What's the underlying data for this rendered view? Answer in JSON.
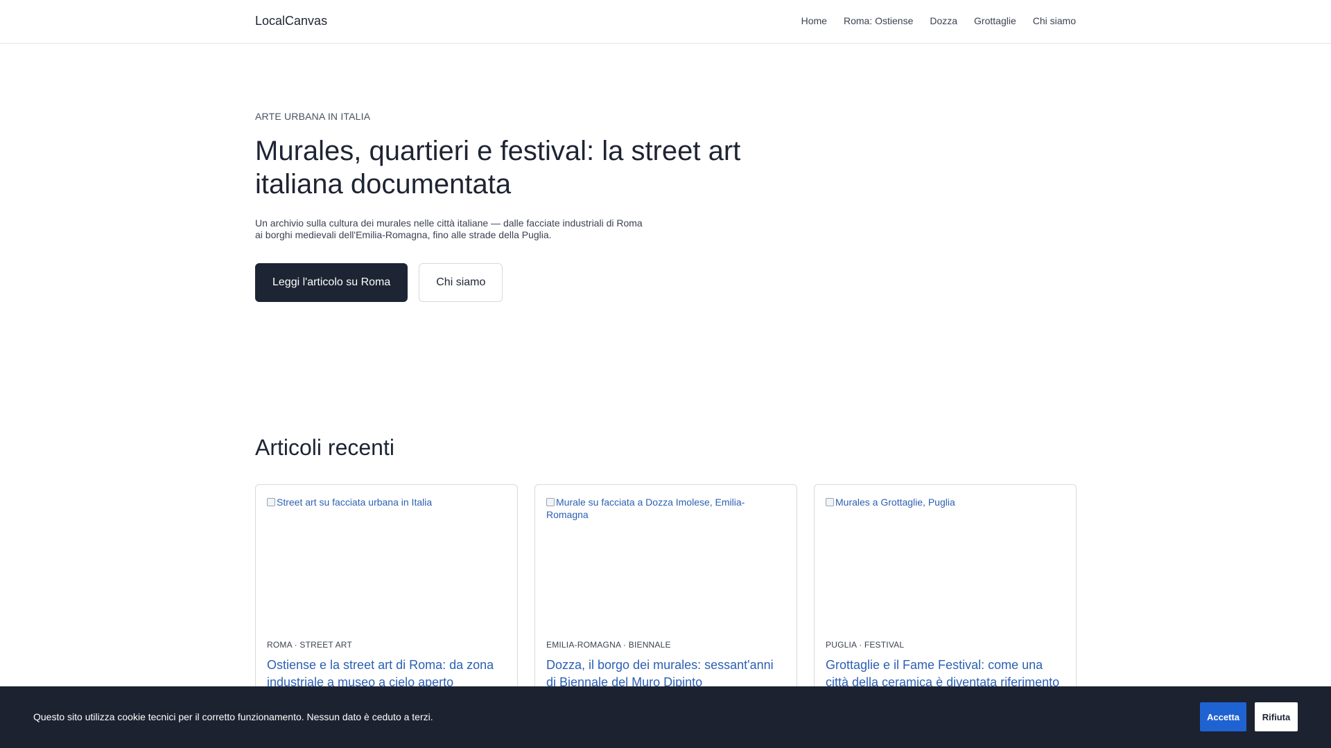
{
  "header": {
    "brand": "LocalCanvas",
    "nav": [
      "Home",
      "Roma: Ostiense",
      "Dozza",
      "Grottaglie",
      "Chi siamo"
    ]
  },
  "hero": {
    "eyebrow": "ARTE URBANA IN ITALIA",
    "title": "Murales, quartieri e festival: la street art italiana documentata",
    "lead": "Un archivio sulla cultura dei murales nelle città italiane — dalle facciate industriali di Roma ai borghi medievali dell'Emilia-Romagna, fino alle strade della Puglia.",
    "primary_cta": "Leggi l'articolo su Roma",
    "secondary_cta": "Chi siamo"
  },
  "recent": {
    "title": "Articoli recenti",
    "cards": [
      {
        "image_alt": "Street art su facciata urbana in Italia",
        "meta": "ROMA · STREET ART",
        "title": "Ostiense e la street art di Roma: da zona industriale a museo a cielo aperto"
      },
      {
        "image_alt": "Murale su facciata a Dozza Imolese, Emilia-Romagna",
        "meta": "EMILIA-ROMAGNA · BIENNALE",
        "title": "Dozza, il borgo dei murales: sessant'anni di Biennale del Muro Dipinto"
      },
      {
        "image_alt": "Murales a Grottaglie, Puglia",
        "meta": "PUGLIA · FESTIVAL",
        "title": "Grottaglie e il Fame Festival: come una città della ceramica è diventata riferimento"
      }
    ]
  },
  "cookie": {
    "text": "Questo sito utilizza cookie tecnici per il corretto funzionamento. Nessun dato è ceduto a terzi.",
    "accept": "Accetta",
    "reject": "Rifiuta"
  },
  "colors": {
    "accent": "#1f63d3",
    "link": "#2b5fb3",
    "dark": "#1d2433",
    "cookie_bg": "#1c2230"
  }
}
